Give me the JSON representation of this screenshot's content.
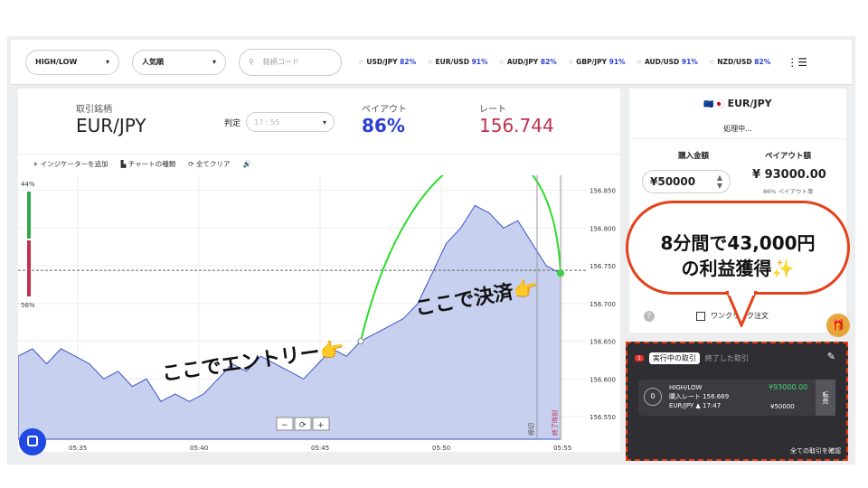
{
  "topbar": {
    "mode_select": "HIGH/LOW",
    "sort_select": "人気順",
    "search_placeholder": "銘柄コード",
    "pairs": [
      {
        "name": "USD/JPY",
        "pct": "82%"
      },
      {
        "name": "EUR/USD",
        "pct": "91%"
      },
      {
        "name": "AUD/JPY",
        "pct": "82%"
      },
      {
        "name": "GBP/JPY",
        "pct": "91%"
      },
      {
        "name": "AUD/USD",
        "pct": "91%"
      },
      {
        "name": "NZD/USD",
        "pct": "82%"
      }
    ]
  },
  "info": {
    "symbol_label": "取引銘柄",
    "symbol": "EUR/JPY",
    "judge_label": "判定",
    "judge_time": "17 : 55",
    "payout_label": "ペイアウト",
    "payout": "86%",
    "rate_label": "レート",
    "rate": "156.744"
  },
  "toolbar": {
    "indicator": "インジケーターを追加",
    "chart_type": "チャートの種類",
    "clear": "全てクリア"
  },
  "chart_data": {
    "type": "area",
    "x_ticks": [
      "05:35",
      "05:40",
      "05:45",
      "05:50",
      "05:55"
    ],
    "y_ticks": [
      156.85,
      156.8,
      156.75,
      156.7,
      156.65,
      156.6,
      156.55
    ],
    "ylim": [
      156.52,
      156.87
    ],
    "current_rate": 156.744,
    "left_top_pct": "44%",
    "left_bottom_pct": "56%",
    "close_label": "締切",
    "end_label": "終了時刻",
    "values": [
      156.63,
      156.64,
      156.62,
      156.64,
      156.63,
      156.62,
      156.6,
      156.61,
      156.59,
      156.6,
      156.57,
      156.58,
      156.57,
      156.58,
      156.6,
      156.62,
      156.61,
      156.63,
      156.62,
      156.61,
      156.6,
      156.62,
      156.64,
      156.63,
      156.65,
      156.66,
      156.67,
      156.68,
      156.7,
      156.74,
      156.78,
      156.8,
      156.83,
      156.82,
      156.8,
      156.81,
      156.78,
      156.75,
      156.74
    ]
  },
  "annotations": {
    "entry": "ここでエントリー",
    "settle": "ここで決済",
    "callout_line1": "8分間で43,000円",
    "callout_line2": "の利益獲得",
    "sparkle": "✨"
  },
  "order": {
    "pair": "EUR/JPY",
    "status": "処理中...",
    "amount_label": "購入金額",
    "payout_label": "ペイアウト額",
    "amount": "¥50000",
    "payout_amount": "¥ 93000.00",
    "payout_rate": "86% ペイアウト率",
    "one_click": "ワンクリック注文"
  },
  "positions": {
    "tab_active": "実行中の取引",
    "tab_done": "終了した取引",
    "badge": "1",
    "type": "HIGH/LOW",
    "buy_rate": "購入レート 156.669",
    "pair_time": "EUR/JPY ▲ 17:47",
    "payout": "¥93000.00",
    "amount": "¥50000",
    "resell": "転売",
    "confirm_all": "全ての取引を確認"
  }
}
